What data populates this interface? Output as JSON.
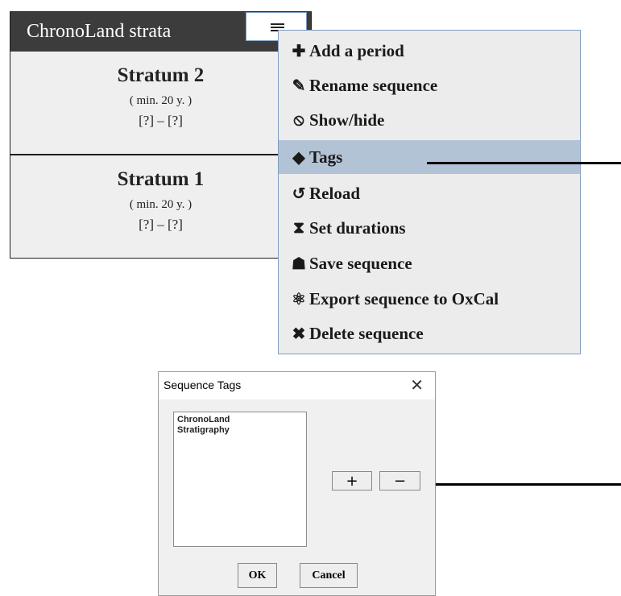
{
  "sequence": {
    "title": "ChronoLand strata",
    "menu_button_icon": "hamburger-icon",
    "strata": [
      {
        "name": "Stratum 2",
        "min": "( min. 20 y. )",
        "range": "[?]  –  [?]"
      },
      {
        "name": "Stratum 1",
        "min": "( min. 20 y. )",
        "range": "[?]  –  [?]"
      }
    ]
  },
  "menu": {
    "items": [
      {
        "label": "Add a period",
        "icon": "plus-icon",
        "glyph": "✚"
      },
      {
        "label": "Rename sequence",
        "icon": "edit-icon",
        "glyph": "✎"
      },
      {
        "label": "Show/hide",
        "icon": "eye-slash-icon",
        "glyph": "⦸"
      },
      {
        "label": "Tags",
        "icon": "tag-icon",
        "glyph": "◆",
        "selected": true
      },
      {
        "label": "Reload",
        "icon": "reload-icon",
        "glyph": "↺"
      },
      {
        "label": "Set durations",
        "icon": "hourglass-icon",
        "glyph": "⧗"
      },
      {
        "label": "Save sequence",
        "icon": "save-icon",
        "glyph": "☗"
      },
      {
        "label": "Export sequence to OxCal",
        "icon": "atom-icon",
        "glyph": "⚛"
      },
      {
        "label": "Delete sequence",
        "icon": "x-icon",
        "glyph": "✖"
      }
    ]
  },
  "dialog": {
    "title": "Sequence Tags",
    "close_glyph": "✕",
    "tags": [
      "ChronoLand",
      "Stratigraphy"
    ],
    "add_label": "+",
    "remove_label": "−",
    "ok_label": "OK",
    "cancel_label": "Cancel"
  },
  "colors": {
    "header_bg": "#3c3c3c",
    "menu_highlight": "#b3c3d6",
    "menu_border": "#7e9cbf"
  }
}
